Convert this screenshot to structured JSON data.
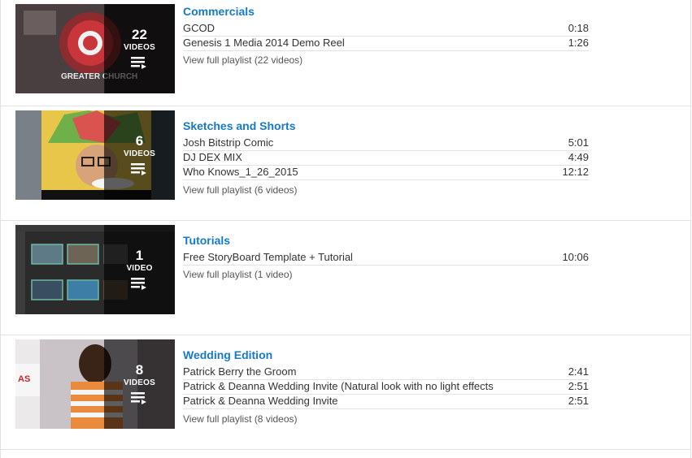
{
  "playlists": [
    {
      "title": "Commercials",
      "count": "22",
      "unit": "VIDEOS",
      "thumb_text": "GREATER CHURCH",
      "videos": [
        {
          "name": "GCOD",
          "duration": "0:18"
        },
        {
          "name": "Genesis 1 Media 2014 Demo Reel",
          "duration": "1:26"
        }
      ],
      "view_all": "View full playlist (22 videos)"
    },
    {
      "title": "Sketches and Shorts",
      "count": "6",
      "unit": "VIDEOS",
      "thumb_text": "",
      "videos": [
        {
          "name": "Josh Bitstrip Comic",
          "duration": "5:01"
        },
        {
          "name": "DJ DEX MIX",
          "duration": "4:49"
        },
        {
          "name": "Who Knows_1_26_2015",
          "duration": "12:12"
        }
      ],
      "view_all": "View full playlist (6 videos)"
    },
    {
      "title": "Tutorials",
      "count": "1",
      "unit": "VIDEO",
      "thumb_text": "",
      "videos": [
        {
          "name": "Free StoryBoard Template + Tutorial",
          "duration": "10:06"
        }
      ],
      "view_all": "View full playlist (1 video)"
    },
    {
      "title": "Wedding Edition",
      "count": "8",
      "unit": "VIDEOS",
      "thumb_text": "AS",
      "videos": [
        {
          "name": "Patrick Berry the Groom",
          "duration": "2:41"
        },
        {
          "name": "Patrick & Deanna Wedding Invite (Natural look with no light effects",
          "duration": "2:51"
        },
        {
          "name": "Patrick & Deanna Wedding Invite",
          "duration": "2:51"
        }
      ],
      "view_all": "View full playlist (8 videos)"
    }
  ],
  "colors": {
    "link_blue": "#167ac6",
    "divider": "#e2e2e2",
    "overlay": "rgba(0,0,0,0.62)"
  },
  "icons": {
    "playlist": "playlist-icon"
  }
}
